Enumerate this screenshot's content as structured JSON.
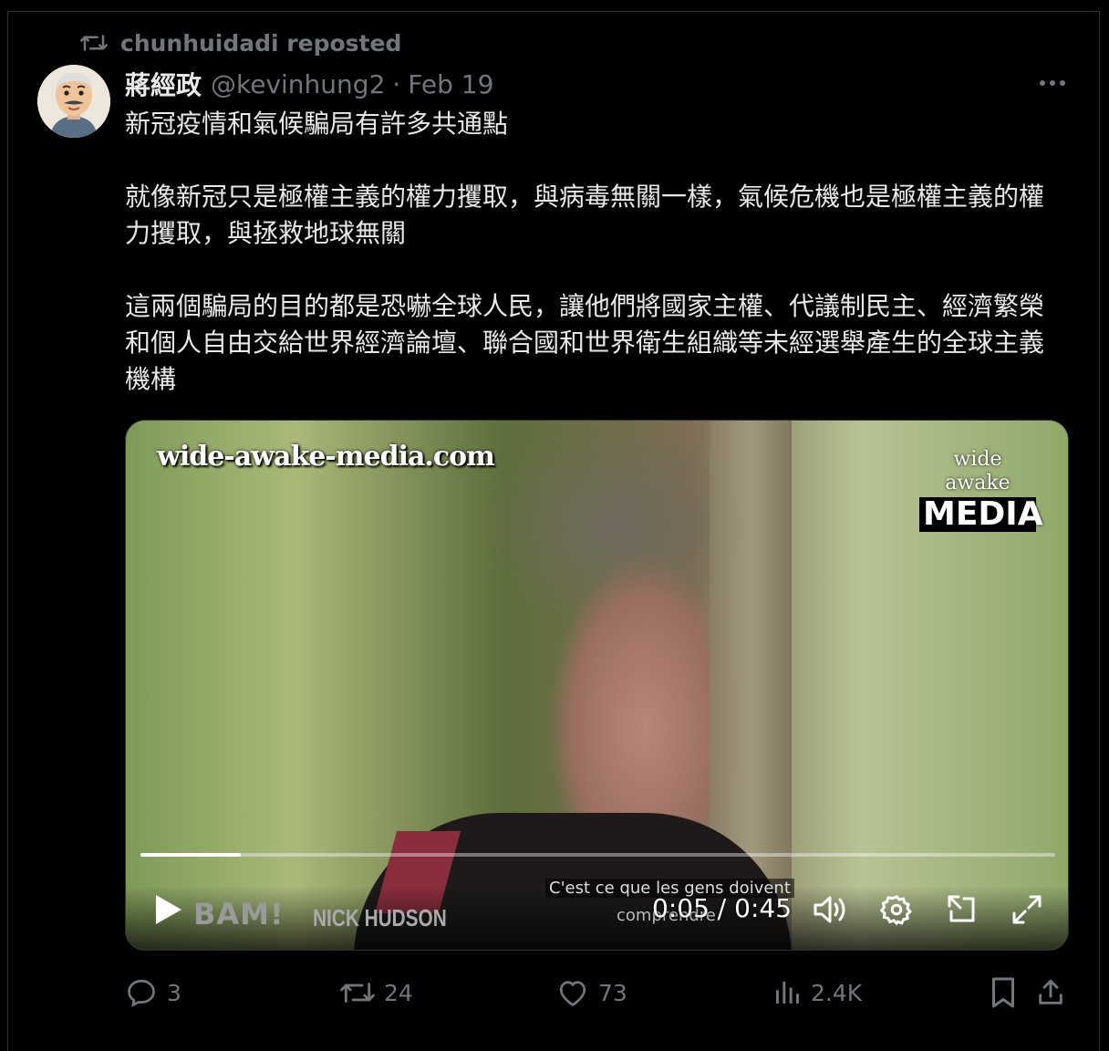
{
  "repost": {
    "text": "chunhuidadi reposted",
    "icon": "repost-icon"
  },
  "author": {
    "name": "蔣經政",
    "handle": "@kevinhung2",
    "separator": "·",
    "date": "Feb 19",
    "avatar_icon": "cartoon-avatar"
  },
  "tweet": {
    "paragraphs": [
      "新冠疫情和氣候騙局有許多共通點",
      "就像新冠只是極權主義的權力攫取，與病毒無關一樣，氣候危機也是極權主義的權力攫取，與拯救地球無關",
      "這兩個騙局的目的都是恐嚇全球人民，讓他們將國家主權、代議制民主、經濟繁榮和個人自由交給世界經濟論壇、聯合國和世界衛生組織等未經選舉產生的全球主義機構"
    ]
  },
  "video": {
    "watermark_left": "wide-awake-media.com",
    "watermark_right_top": "wide awake",
    "watermark_right_bottom": "MEDIA",
    "lower_third_logo": "BAM!",
    "lower_third_name": "NICK HUDSON",
    "subtitle_line1": "C'est ce que les gens doivent",
    "subtitle_line2": "comprendre.",
    "current_time": "0:05",
    "duration": "0:45",
    "time_separator": " / ",
    "progress_fraction": 0.11
  },
  "actions": {
    "replies": "3",
    "reposts": "24",
    "likes": "73",
    "views": "2.4K"
  },
  "colors": {
    "background": "#000000",
    "text": "#e7e9ea",
    "muted": "#71767b",
    "border": "#2f3336"
  }
}
